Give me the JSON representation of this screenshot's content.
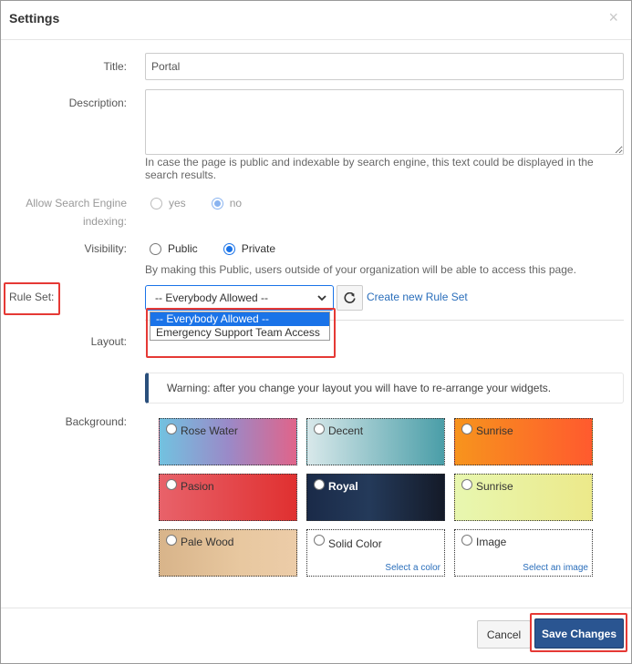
{
  "dialog": {
    "title": "Settings",
    "close_glyph": "×"
  },
  "form": {
    "title_label": "Title:",
    "title_value": "Portal",
    "description_label": "Description:",
    "description_value": "",
    "description_help": "In case the page is public and indexable by search engine, this text could be displayed in the search results.",
    "indexing_label_line1": "Allow Search Engine",
    "indexing_label_line2": "indexing:",
    "indexing_options": [
      "yes",
      "no"
    ],
    "indexing_selected": "no",
    "visibility_label": "Visibility:",
    "visibility_options": [
      "Public",
      "Private"
    ],
    "visibility_selected": "Private",
    "visibility_help": "By making this Public, users outside of your organization will be able to access this page.",
    "ruleset_label": "Rule Set:",
    "ruleset_selected": "-- Everybody Allowed --",
    "ruleset_options": [
      "-- Everybody Allowed --",
      "Emergency Support Team Access"
    ],
    "create_ruleset_link": "Create new Rule Set",
    "layout_label": "Layout:",
    "layout_warning": "Warning: after you change your layout you will have to re-arrange your widgets.",
    "background_label": "Background:",
    "backgrounds": [
      {
        "name": "Rose Water",
        "style": "gradient"
      },
      {
        "name": "Decent",
        "style": "gradient"
      },
      {
        "name": "Sunrise",
        "style": "gradient"
      },
      {
        "name": "Pasion",
        "style": "gradient"
      },
      {
        "name": "Royal",
        "style": "gradient"
      },
      {
        "name": "Sunrise",
        "style": "gradient"
      },
      {
        "name": "Pale Wood",
        "style": "gradient"
      },
      {
        "name": "Solid Color",
        "sub": "Select a color"
      },
      {
        "name": "Image",
        "sub": "Select an image"
      }
    ]
  },
  "footer": {
    "cancel_label": "Cancel",
    "save_label": "Save Changes"
  },
  "colors": {
    "primary": "#2a5591",
    "highlight_box": "#e53935",
    "link": "#2a6ebb",
    "select_focus": "#1a73e8"
  },
  "icons": {
    "refresh": "refresh-icon",
    "chevron": "chevron-down-icon"
  }
}
